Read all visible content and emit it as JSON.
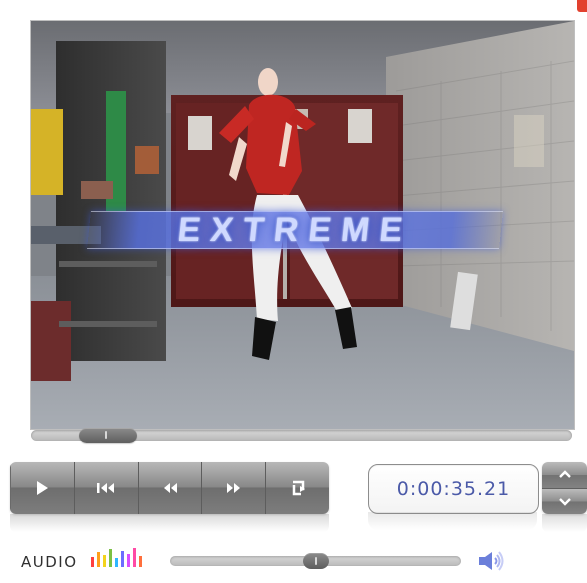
{
  "video": {
    "overlay_title": "EXTREME",
    "scene_description": ""
  },
  "controls": {
    "icons": {
      "play": "play-icon",
      "skip_back": "skip-back-icon",
      "rewind": "rewind-icon",
      "fast_forward": "fast-forward-icon",
      "repeat": "repeat-icon",
      "speaker": "speaker-icon",
      "audio_levels": "audio-levels-icon",
      "step_up": "chevron-up-icon",
      "step_down": "chevron-down-icon"
    },
    "time_display": "0:00:35.21"
  },
  "audio": {
    "label": "AUDIO",
    "level_colors": [
      "#ff3f3f",
      "#ff9f1a",
      "#f3d31d",
      "#7bc043",
      "#2fb6ff",
      "#6d6dff",
      "#d94cff",
      "#ff4aa5",
      "#ff6f3c"
    ]
  },
  "progress": {
    "seek_percent": 10,
    "volume_percent": 50
  },
  "theme": {
    "accent_time_text": "#4b5aa8",
    "control_gray": "#7f7f7f",
    "video_title_blue": "#5f74d9",
    "corner_mark": "#e2412f"
  }
}
